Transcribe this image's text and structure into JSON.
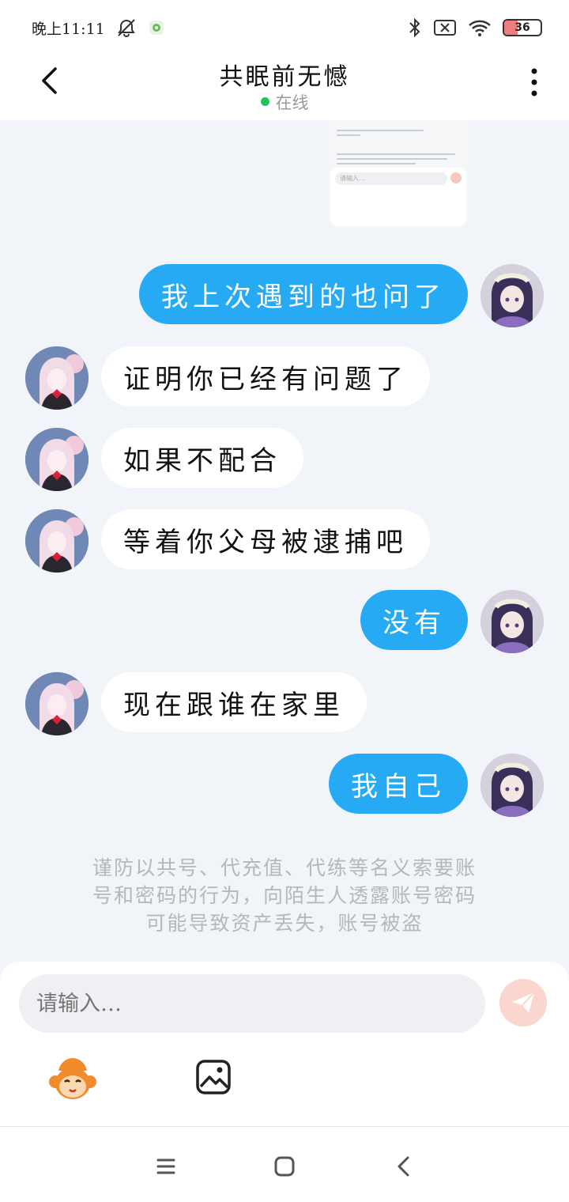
{
  "status_bar": {
    "time": "晚上11:11",
    "battery": "36",
    "battery_level_percent": 36,
    "icons": [
      "alarm-off-icon",
      "app-notification-icon",
      "bluetooth-icon",
      "no-sim-icon",
      "wifi-icon",
      "battery-icon"
    ]
  },
  "header": {
    "title": "共眠前无憾",
    "status": "在线",
    "status_color": "#22c25a"
  },
  "shared_image": {
    "input_placeholder": "请输入…"
  },
  "messages": [
    {
      "from": "me",
      "text": "我上次遇到的也问了"
    },
    {
      "from": "them",
      "text": "证明你已经有问题了"
    },
    {
      "from": "them",
      "text": "如果不配合"
    },
    {
      "from": "them",
      "text": "等着你父母被逮捕吧"
    },
    {
      "from": "me",
      "text": "没有"
    },
    {
      "from": "them",
      "text": "现在跟谁在家里"
    },
    {
      "from": "me",
      "text": "我自己"
    }
  ],
  "notice": {
    "line1": "谨防以共号、代充值、代练等名义索要账",
    "line2": "号和密码的行为，向陌生人透露账号密码",
    "line3": "可能导致资产丢失，账号被盗"
  },
  "composer": {
    "placeholder": "请输入…"
  },
  "colors": {
    "my_bubble": "#27aaf4",
    "their_bubble": "#ffffff",
    "background": "#f1f4f8",
    "send_button": "#fbd6cf"
  }
}
